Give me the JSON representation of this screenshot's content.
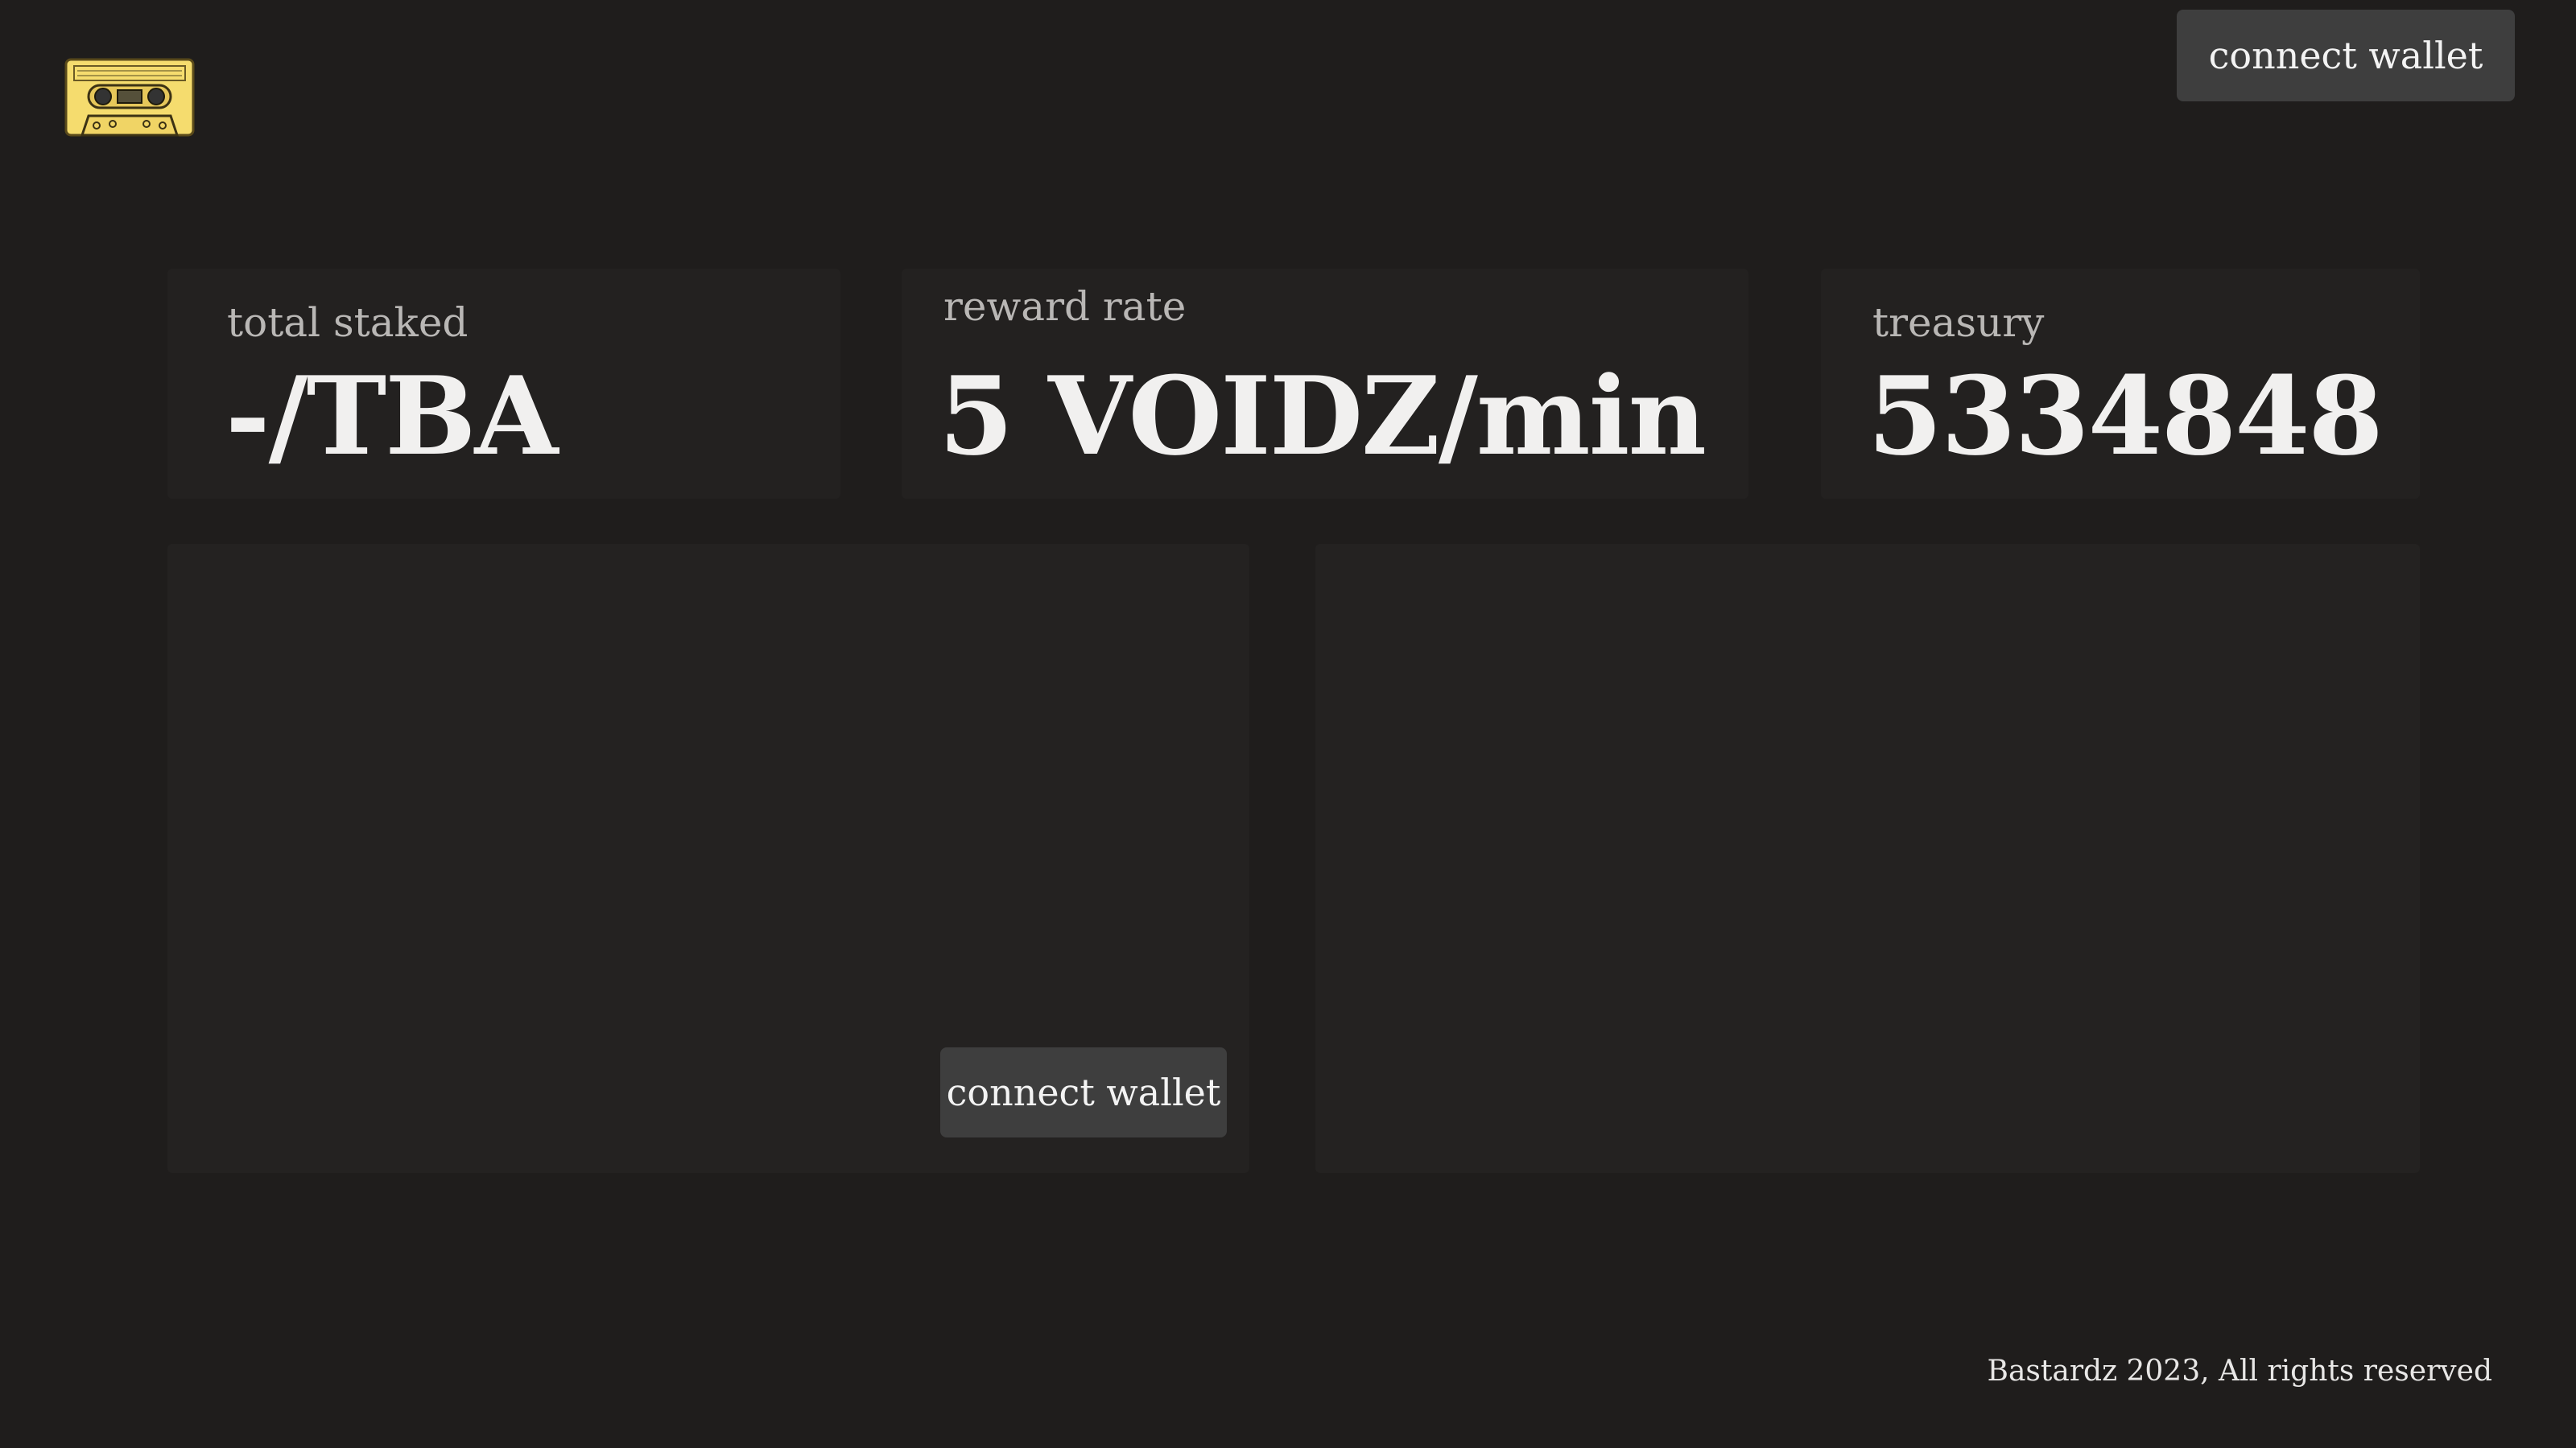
{
  "header": {
    "logo_icon": "cassette-tape-icon",
    "connect_wallet_label": "connect wallet"
  },
  "stats": {
    "total_staked": {
      "label": "total staked",
      "value": "-/TBA"
    },
    "reward_rate": {
      "label": "reward rate",
      "value": "5 VOIDZ/min"
    },
    "treasury": {
      "label": "treasury",
      "value": "5334848"
    }
  },
  "main": {
    "left_panel": {
      "connect_wallet_label": "connect wallet"
    },
    "right_panel": {}
  },
  "footer": {
    "text": "Bastardz 2023, All rights reserved"
  },
  "colors": {
    "background": "#1f1d1c",
    "card": "#232120",
    "button": "#3e3e3e",
    "logo_yellow": "#f5dc6e"
  }
}
